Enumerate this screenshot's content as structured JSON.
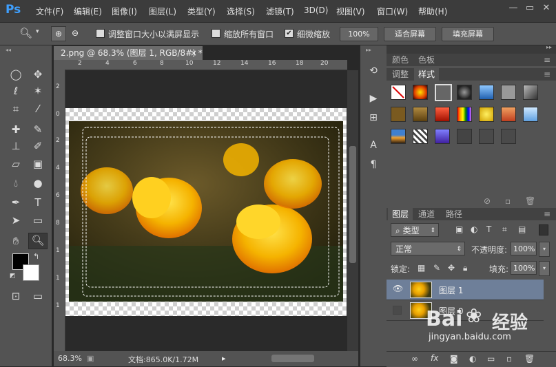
{
  "app": {
    "logo": "Ps"
  },
  "menu": [
    "文件(F)",
    "编辑(E)",
    "图像(I)",
    "图层(L)",
    "类型(Y)",
    "选择(S)",
    "滤镜(T)",
    "3D(D)",
    "视图(V)",
    "窗口(W)",
    "帮助(H)"
  ],
  "window_controls": {
    "minimize": "—",
    "restore": "▭",
    "close": "✕"
  },
  "options": {
    "resize_windows_label": "调整窗口大小以满屏显示",
    "zoom_all_label": "缩放所有窗口",
    "scrubby_label": "细微缩放",
    "zoom_100_label": "100%",
    "fit_screen_label": "适合屏幕",
    "fill_screen_label": "填充屏幕"
  },
  "document": {
    "tab_title": "2.png @ 68.3% (图层 1, RGB/8#) *",
    "close": "×",
    "ruler_h": [
      "2",
      "4",
      "6",
      "8",
      "10",
      "12",
      "14",
      "16",
      "18",
      "20"
    ],
    "ruler_v": [
      "2",
      "0",
      "2",
      "4",
      "6",
      "8",
      "1",
      "1",
      "1"
    ],
    "zoom": "68.3%",
    "doc_size": "文档:865.0K/1.72M"
  },
  "styles_panel": {
    "tabs_top": [
      "颜色",
      "色板"
    ],
    "tabs_bottom": [
      "调整",
      "样式"
    ]
  },
  "layers_panel": {
    "tabs": [
      "图层",
      "通道",
      "路径"
    ],
    "filter_kind": "类型",
    "blend_mode": "正常",
    "opacity_label": "不透明度:",
    "opacity_value": "100%",
    "lock_label": "锁定:",
    "fill_label": "填充:",
    "fill_value": "100%",
    "layers": [
      {
        "name": "图层 1",
        "visible": true,
        "selected": true
      },
      {
        "name": "图层 0",
        "visible": false,
        "selected": false
      }
    ]
  },
  "watermark": {
    "brand": "Bai",
    "brand2": "经验",
    "url": "jingyan.baidu.com"
  },
  "colors": {
    "accent": "#3fa0ff",
    "selected_layer": "#6e7f99"
  }
}
